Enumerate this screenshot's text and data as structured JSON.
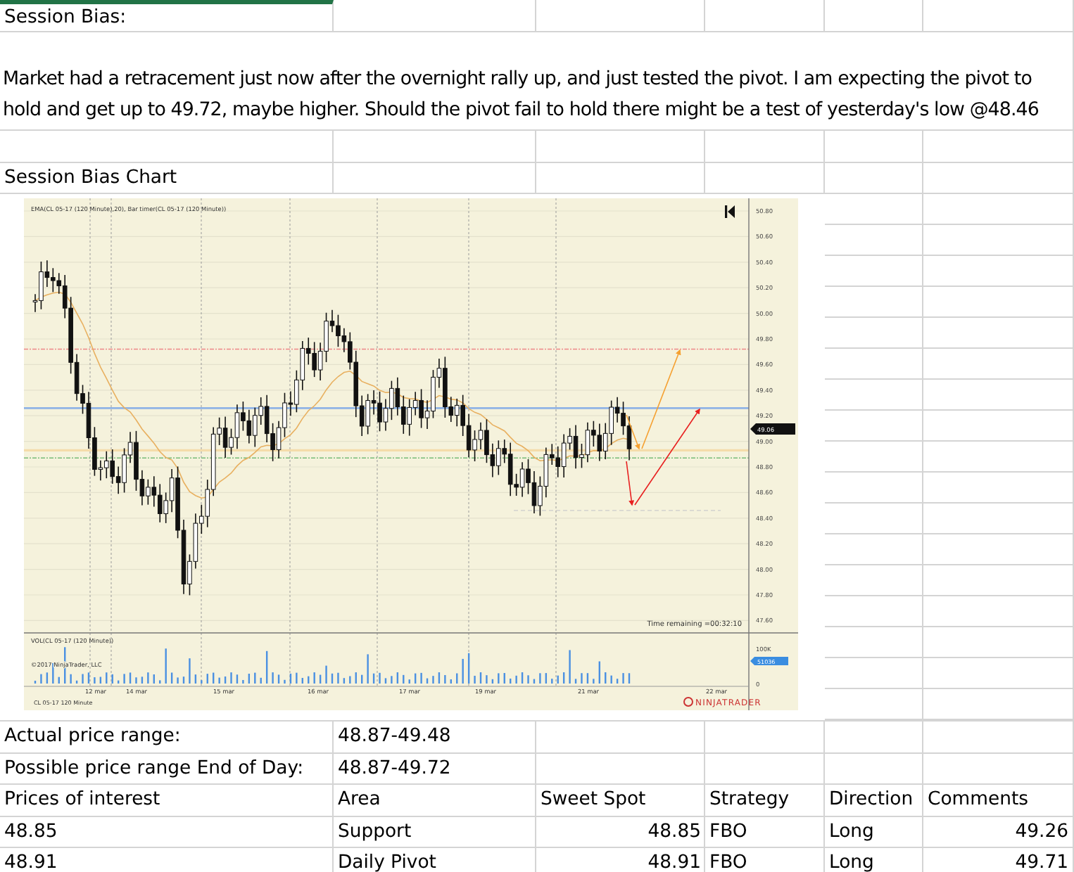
{
  "header": {
    "label": "Session Bias:"
  },
  "note": "Market had a retracement just now after the overnight rally up, and just tested the pivot. I am expecting the pivot to hold and get up to 49.72, maybe higher. Should the pivot fail to hold there might be a test of yesterday's low @48.46",
  "chart": {
    "title": "Session Bias Chart",
    "legend": "EMA(CL 05-17 (120 Minute),20), Bar timer(CL 05-17 (120 Minute))",
    "price_labels": [
      "50.80",
      "50.60",
      "50.40",
      "50.20",
      "50.00",
      "49.80",
      "49.60",
      "49.40",
      "49.20",
      "49.00",
      "48.80",
      "48.60",
      "48.40",
      "48.20",
      "48.00",
      "47.80",
      "47.60"
    ],
    "last_price": "49.06",
    "timer": "Time remaining =00:32:10",
    "volume_legend": "VOL(CL 05-17 (120 Minute))",
    "copyright": "©2017 NinjaTrader, LLC",
    "volume_labels": [
      "100K",
      "0"
    ],
    "last_volume": "51036",
    "dates": [
      "12 mar",
      "14 mar",
      "15 mar",
      "16 mar",
      "17 mar",
      "19 mar",
      "21 mar",
      "22 mar"
    ],
    "instrument": "CL 05-17 120 Minute",
    "brand": "NINJATRADER"
  },
  "ranges": [
    {
      "label": "Actual price range:",
      "value": "48.87-49.48"
    },
    {
      "label": "Possible price range End of Day:",
      "value": "48.87-49.72"
    }
  ],
  "table": {
    "columns": [
      "Prices of interest",
      "Area",
      "Sweet Spot",
      "Strategy",
      "Direction",
      "Comments"
    ],
    "rows": [
      [
        "48.85",
        "Support",
        "48.85",
        "FBO",
        "Long",
        "49.26"
      ],
      [
        "48.91",
        "Daily Pivot",
        "48.91",
        "FBO",
        "Long",
        "49.71"
      ]
    ]
  }
}
